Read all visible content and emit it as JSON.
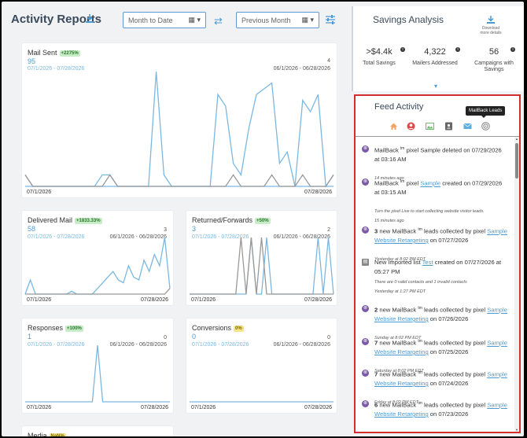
{
  "header": {
    "title": "Activity Reports",
    "period1": "Month to Date",
    "period2": "Previous Month"
  },
  "cards": [
    {
      "title": "Mail Sent",
      "badge": "+2275%",
      "badge_tone": "green",
      "value": "95",
      "range": "07/1/2026 - 07/28/2026",
      "prev_value": "4",
      "prev_range": "06/1/2026 - 06/28/2026",
      "x_start": "07/1/2026",
      "x_end": "07/28/2026"
    },
    {
      "title": "Delivered Mail",
      "badge": "+1833.33%",
      "badge_tone": "green",
      "value": "58",
      "range": "07/1/2026 - 07/28/2026",
      "prev_value": "3",
      "prev_range": "06/1/2026 - 06/28/2026",
      "x_start": "07/1/2026",
      "x_end": "07/28/2026"
    },
    {
      "title": "Returned/Forwards",
      "badge": "+50%",
      "badge_tone": "green",
      "value": "3",
      "range": "07/1/2026 - 07/28/2026",
      "prev_value": "2",
      "prev_range": "06/1/2026 - 06/28/2026",
      "x_start": "07/1/2026",
      "x_end": "07/28/2026"
    },
    {
      "title": "Responses",
      "badge": "+100%",
      "badge_tone": "green",
      "value": "1",
      "range": "07/1/2026 - 07/28/2026",
      "prev_value": "0",
      "prev_range": "06/1/2026 - 06/28/2026",
      "x_start": "07/1/2026",
      "x_end": "07/28/2026"
    },
    {
      "title": "Conversions",
      "badge": "0%",
      "badge_tone": "yellow",
      "value": "0",
      "range": "07/1/2026 - 07/28/2026",
      "prev_value": "0",
      "prev_range": "06/1/2026 - 06/28/2026",
      "x_start": "07/1/2026",
      "x_end": "07/28/2026"
    },
    {
      "title": "Media",
      "badge": "NaN%",
      "badge_tone": "yellow"
    }
  ],
  "savings": {
    "title": "Savings Analysis",
    "download": "Download more details",
    "metrics": [
      {
        "value": ">$4.4k",
        "label": "Total Savings"
      },
      {
        "value": "4,322",
        "label": "Mailers Addressed"
      },
      {
        "value": "56",
        "label": "Campaigns with Savings"
      }
    ]
  },
  "feed": {
    "title": "Feed Activity",
    "tooltip": "MailBack Leads",
    "tab_icons": [
      "home-icon",
      "person-icon",
      "image-icon",
      "contact-icon",
      "mail-icon",
      "target-icon"
    ],
    "items": [
      {
        "icon": "mailback",
        "html_pre": "MailBack ",
        "tm": "tm",
        "html_post": " pixel Sample deleted on 07/29/2026 at 03:16 AM",
        "sub": [
          "14 minutes ago"
        ]
      },
      {
        "icon": "mailback",
        "html_pre": "MailBack ",
        "tm": "tm",
        "html_post": " pixel ",
        "link": "Sample",
        "tail": " created on 07/29/2026 at 03:15 AM",
        "sub": [
          "Turn the pixel Live to start collecting website visitor leads.",
          "15 minutes ago"
        ]
      },
      {
        "icon": "mailback",
        "bold": "3",
        "html_pre": " new MailBack ",
        "tm": "tm",
        "html_post": " leads collected by pixel ",
        "link": "Sample Website Retargeting",
        "tail": " on 07/27/2026",
        "sub": [
          "Yesterday at 8:02 PM EDT"
        ]
      },
      {
        "icon": "list",
        "html_pre": "New Imported list ",
        "link": "Test",
        "tail": " created on 07/27/2026 at 05:27 PM",
        "sub": [
          "There are 0 valid contacts and 1 invalid contacts",
          "Yesterday at 1:27 PM EDT"
        ]
      },
      {
        "icon": "mailback",
        "bold": "2",
        "html_pre": " new MailBack ",
        "tm": "tm",
        "html_post": " leads collected by pixel ",
        "link": "Sample Website Retargeting",
        "tail": " on 07/26/2026",
        "sub": [
          "Sunday at 8:02 PM EDT"
        ]
      },
      {
        "icon": "mailback",
        "bold": "7",
        "html_pre": " new MailBack ",
        "tm": "tm",
        "html_post": " leads collected by pixel ",
        "link": "Sample Website Retargeting",
        "tail": " on 07/25/2026",
        "sub": [
          "Saturday at 8:02 PM EDT"
        ]
      },
      {
        "icon": "mailback",
        "bold": "7",
        "html_pre": " new MailBack ",
        "tm": "tm",
        "html_post": " leads collected by pixel ",
        "link": "Sample Website Retargeting",
        "tail": " on 07/24/2026",
        "sub": [
          "Friday at 8:02 PM EDT"
        ]
      },
      {
        "icon": "mailback",
        "bold": "6",
        "html_pre": " new MailBack ",
        "tm": "tm",
        "html_post": " leads collected by pixel ",
        "link": "Sample Website Retargeting",
        "tail": " on 07/23/2026",
        "sub": []
      }
    ]
  },
  "colors": {
    "accent": "#4a9bd4",
    "current": "#7ab8e2",
    "previous": "#999999",
    "feed_border": "#d32f2f"
  },
  "chart_data": [
    {
      "type": "line",
      "title": "Mail Sent",
      "series": [
        {
          "values": [
            0,
            0,
            0,
            0,
            0,
            0,
            0,
            0,
            0,
            0,
            0,
            0,
            0,
            0,
            0,
            0,
            0,
            0,
            0,
            0,
            0,
            0,
            0,
            0,
            0,
            0,
            0,
            0,
            0,
            0,
            0,
            0,
            0,
            0,
            0,
            0,
            0,
            0,
            0,
            0,
            0,
            0,
            0,
            0,
            0,
            0,
            0,
            0,
            0,
            0,
            0,
            0,
            0,
            0,
            0,
            0,
            0,
            0,
            0,
            0,
            0,
            0,
            0,
            0,
            0,
            0,
            0,
            0,
            0,
            0,
            0,
            0,
            0,
            0,
            0,
            0,
            0,
            0,
            0,
            0,
            0,
            0,
            0,
            0,
            0,
            0,
            0,
            0,
            0,
            0,
            0,
            0,
            0,
            0,
            0,
            0,
            0
          ]
        },
        {
          "values": [
            0.1,
            0,
            0,
            0,
            0,
            0,
            0,
            0,
            0,
            0,
            0.1,
            0.1,
            0,
            0,
            0,
            0,
            0,
            1,
            0.1,
            0,
            0,
            0,
            0,
            0,
            0,
            0.8,
            0.7,
            0.2,
            0.1,
            0.5,
            0.8,
            0.85,
            0.9,
            0.2,
            0.3,
            0,
            0.75,
            0.65,
            0.8,
            0,
            0.1
          ]
        },
        {
          "values": [
            0.1,
            0,
            0,
            0,
            0,
            0,
            0,
            0,
            0,
            0,
            0,
            0.1,
            0,
            0,
            0,
            0,
            0,
            0,
            0,
            0,
            0,
            0,
            0,
            0,
            0,
            0,
            0,
            0.1,
            0,
            0,
            0,
            0,
            0.1,
            0,
            0,
            0,
            0.1,
            0,
            0,
            0,
            0.1
          ]
        }
      ]
    },
    {
      "type": "line",
      "title": "Delivered Mail",
      "series": [
        {
          "values": [
            0,
            0.25,
            0,
            0,
            0,
            0,
            0,
            0,
            0,
            0.05,
            0,
            0,
            0,
            0,
            0.1,
            0.2,
            0.3,
            0.4,
            0.25,
            0.2,
            0.5,
            0.3,
            0.25,
            0.6,
            0.4,
            0.7,
            0.5,
            1,
            0.1
          ]
        },
        {
          "values": [
            0,
            0,
            0,
            0,
            0,
            0,
            0,
            0,
            0,
            0,
            0,
            0,
            0,
            0,
            0,
            0,
            0,
            0,
            0,
            0,
            0,
            0,
            0,
            0,
            0,
            0,
            0,
            0,
            0.1
          ]
        }
      ]
    },
    {
      "type": "line",
      "title": "Returned/Forwards",
      "series": [
        {
          "values": [
            0,
            0,
            0,
            0,
            0,
            0,
            0,
            0,
            0,
            0,
            0,
            0,
            1,
            0,
            0,
            1,
            0,
            0,
            0,
            0,
            0,
            0,
            0,
            0,
            0,
            1,
            0,
            1,
            0
          ]
        },
        {
          "values": [
            0,
            0,
            0,
            0,
            0,
            0,
            0,
            0,
            0,
            0,
            1,
            0,
            1,
            0,
            1,
            0,
            0,
            0,
            0,
            0,
            0,
            0,
            0,
            0,
            0,
            0,
            0,
            0,
            0
          ]
        }
      ]
    },
    {
      "type": "line",
      "title": "Responses",
      "series": [
        {
          "values": [
            0,
            0,
            0,
            0,
            0,
            0,
            0,
            0,
            0,
            0,
            0,
            0,
            0,
            0,
            1,
            0,
            0,
            0,
            0,
            0,
            0,
            0,
            0,
            0,
            0,
            0,
            0,
            0,
            0
          ]
        }
      ]
    },
    {
      "type": "line",
      "title": "Conversions",
      "series": [
        {
          "values": [
            0,
            0,
            0,
            0,
            0,
            0,
            0,
            0,
            0,
            0,
            0,
            0,
            0,
            0,
            0,
            0,
            0,
            0,
            0,
            0,
            0,
            0,
            0,
            0,
            0,
            0,
            0,
            0,
            0
          ]
        }
      ]
    }
  ]
}
